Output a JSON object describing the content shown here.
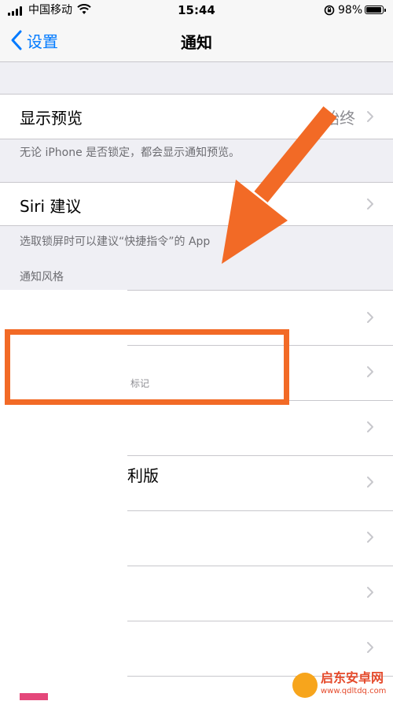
{
  "status": {
    "carrier": "中国移动",
    "time": "15:44",
    "battery": "98%",
    "battery_level": 0.98
  },
  "nav": {
    "back_label": "设置",
    "title": "通知"
  },
  "settings": {
    "show_previews": {
      "label": "显示预览",
      "value": "始终"
    },
    "show_previews_footer": "无论 iPhone 是否锁定，都会显示通知预览。",
    "siri": {
      "label": "Siri 建议"
    },
    "siri_footer": "选取锁屏时可以建议“快捷指令”的 App",
    "style_header": "通知风格"
  },
  "partial_rows": {
    "row2_text": "标记",
    "row4_text": "利版"
  },
  "watermark": {
    "title": "启东安卓网",
    "url": "www.qdltdq.com"
  },
  "colors": {
    "accent": "#007aff",
    "annotation": "#f26a26",
    "background": "#efeff4",
    "chevron": "#c7c7cc"
  },
  "icons": [
    "signal-icon",
    "wifi-icon",
    "orientation-lock-icon",
    "battery-icon",
    "back-chevron-icon",
    "chevron-right-icon",
    "arrow-annotation",
    "watermark-logo-icon"
  ]
}
